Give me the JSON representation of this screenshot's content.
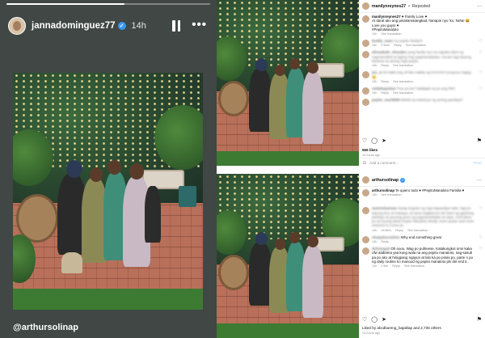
{
  "story": {
    "username": "jannadominguez77",
    "verified_mark": "✓",
    "time": "14h",
    "progress": 0.58,
    "tag": "@arthursolinap",
    "icons": [
      "pause-icon",
      "more-icon"
    ]
  },
  "post1": {
    "username": "manilynreynes27",
    "verified_mark": "✓",
    "separator": "•",
    "reposted": "Reposted",
    "more": "···",
    "caption": {
      "user": "manilynreynes27",
      "lines": [
        "♥ Family Love ♥",
        "At darat ako ang pinakamatangkad, hanapin nyo 'ko, haha! 😆",
        "Love you guys! ♥",
        "#PepitoManaloto"
      ],
      "meta": [
        "14h",
        "See translation"
      ]
    },
    "comments": [
      {
        "user": "buddy_mare",
        "text": "my pepito family!!!",
        "meta": [
          "14h",
          "2 likes",
          "Reply",
          "See translation"
        ]
      },
      {
        "user": "africadudo_shoudes",
        "text": "yung family nyo na napaka dami ng nagmamahal at laging may pagmamahalan, ma'am lagi kayong kasama sa aming mga pepito",
        "meta": [
          "14h",
          "Reply",
          "See translation"
        ]
      },
      {
        "user": "jun_zi",
        "text": "Sir bakit may di kita makita ng HAHAHA lovepocs happy 😊",
        "meta": [
          "14h",
          "Reply",
          "See translation"
        ]
      },
      {
        "user": "seldabapobau",
        "text": "True po ba? Nalalapit na po ang PM?",
        "meta": [
          "14h",
          "Reply",
          "See translation"
        ]
      },
      {
        "user": "pepito_mari9999",
        "text": "Mahal na mahal po ng aming pamilya!!!",
        "meta": []
      }
    ],
    "likes": "566 likes",
    "time_ago": "14 hours ago",
    "comment_placeholder": "Add a comment...",
    "post_button": "Post"
  },
  "post2": {
    "username": "arthursolinap",
    "verified_mark": "✓",
    "more": "···",
    "caption": {
      "user": "arthursolinap",
      "lines": [
        "Te quiero todo ♥ #PepitoManaloto Familia ♥"
      ],
      "meta": [
        "14h",
        "See translation"
      ]
    },
    "comments": [
      {
        "user": "marivickarinan",
        "text": "Sarap tingnan ng mga kapamilya natin, lagi po kayong buo at masaya, at sana magkaroon din kami ng ganitong pamilya na punong puno ng pagmamahalan at saya, God bless po sa inyong lahat Pepito Manaloto family, more power and more seasons to come po",
        "meta": [
          "14h",
          "18 likes",
          "Reply",
          "See translation"
        ]
      },
      {
        "user": "sleepyhursshine",
        "text": "Why end something great",
        "meta": [
          "14h",
          "Reply"
        ]
      },
      {
        "user": "dolonegad",
        "text": "Oh nooo. Wag po puhleese. Katakungkot nmn kaka ofw alabama yaa kung wala na ang pepito manaloto, nag-sasub pa po ako at hinigpang ngayun at lalo ka po pinas po, parte n po ng daily routine ko manood ng pepito manaloto pls dnt end it..",
        "meta": [
          "14h",
          "1 like",
          "Reply",
          "See translation"
        ]
      }
    ],
    "liked_by": "Liked by abcdkareng_bajaklap and 2,735 others",
    "time_ago": "14 hours ago"
  }
}
